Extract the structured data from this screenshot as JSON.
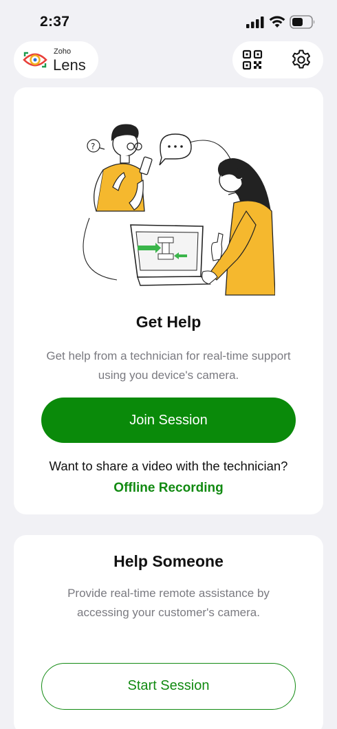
{
  "status_bar": {
    "time": "2:37"
  },
  "header": {
    "logo_brand": "Zoho",
    "logo_product": "Lens",
    "qr_icon": "qr-code-icon",
    "settings_icon": "gear-icon"
  },
  "get_help": {
    "title": "Get Help",
    "description": "Get help from a technician for real-time support using you device's camera.",
    "join_label": "Join Session",
    "share_question": "Want to share a video with the technician?",
    "offline_label": "Offline Recording"
  },
  "help_someone": {
    "title": "Help Someone",
    "description": "Provide real-time remote assistance by accessing your customer's camera.",
    "start_label": "Start Session"
  },
  "colors": {
    "primary": "#0a8a0a",
    "background": "#f1f1f5",
    "illustration_accent": "#f5b82e"
  }
}
